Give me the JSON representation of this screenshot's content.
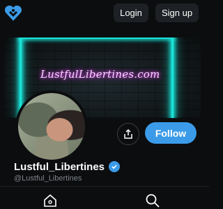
{
  "header": {
    "login_label": "Login",
    "signup_label": "Sign up"
  },
  "cover": {
    "neon_text": "LustfulLibertines.com"
  },
  "profile": {
    "display_name": "Lustful_Libertines",
    "handle": "@Lustful_Libertines",
    "follow_label": "Follow",
    "verified": true
  },
  "icons": {
    "logo": "heart-logo-icon",
    "share": "share-icon",
    "verified": "verified-badge-icon",
    "home": "home-icon",
    "search": "search-icon"
  },
  "colors": {
    "background": "#0c0d0f",
    "accent": "#3b9be8",
    "neon_cyan": "#19e3d8",
    "neon_pink": "#e34cf0"
  }
}
